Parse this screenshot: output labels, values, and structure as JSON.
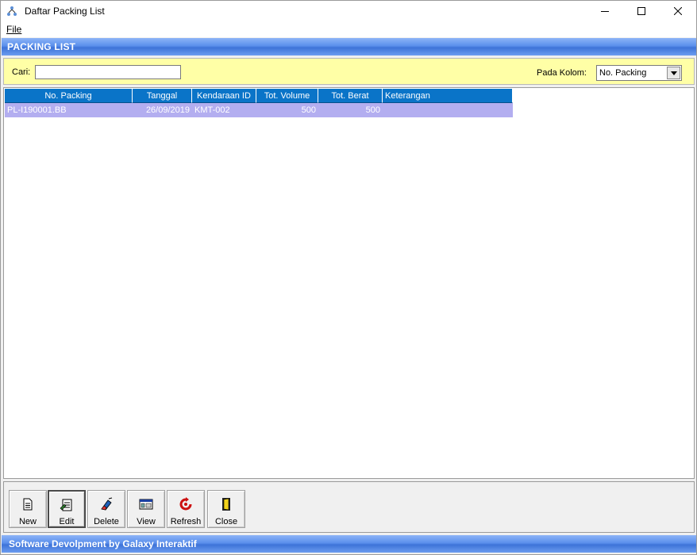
{
  "window": {
    "title": "Daftar Packing List",
    "icon": "app-tree-icon"
  },
  "menu": {
    "items": [
      {
        "label": "File",
        "accel": "F"
      }
    ]
  },
  "header": {
    "title": "PACKING LIST"
  },
  "search": {
    "label": "Cari:",
    "value": "",
    "column_label": "Pada Kolom:",
    "column_selected": "No. Packing"
  },
  "grid": {
    "columns": [
      "No. Packing",
      "Tanggal",
      "Kendaraan ID",
      "Tot. Volume",
      "Tot. Berat",
      "Keterangan"
    ],
    "rows": [
      [
        "PL-I190001.BB",
        "26/09/2019",
        "KMT-002",
        "500",
        "500",
        ""
      ]
    ]
  },
  "toolbar": {
    "buttons": [
      {
        "label": "New",
        "icon": "new-document-icon"
      },
      {
        "label": "Edit",
        "icon": "edit-document-icon"
      },
      {
        "label": "Delete",
        "icon": "eraser-icon"
      },
      {
        "label": "View",
        "icon": "view-window-icon"
      },
      {
        "label": "Refresh",
        "icon": "refresh-icon"
      },
      {
        "label": "Close",
        "icon": "exit-door-icon"
      }
    ]
  },
  "footer": {
    "text": "Software Devolpment by Galaxy Interaktif"
  },
  "colors": {
    "header_blue": "#3d73d8",
    "grid_header": "#0a74c8",
    "selected_row": "#b3aef0",
    "search_panel": "#ffffa6"
  }
}
